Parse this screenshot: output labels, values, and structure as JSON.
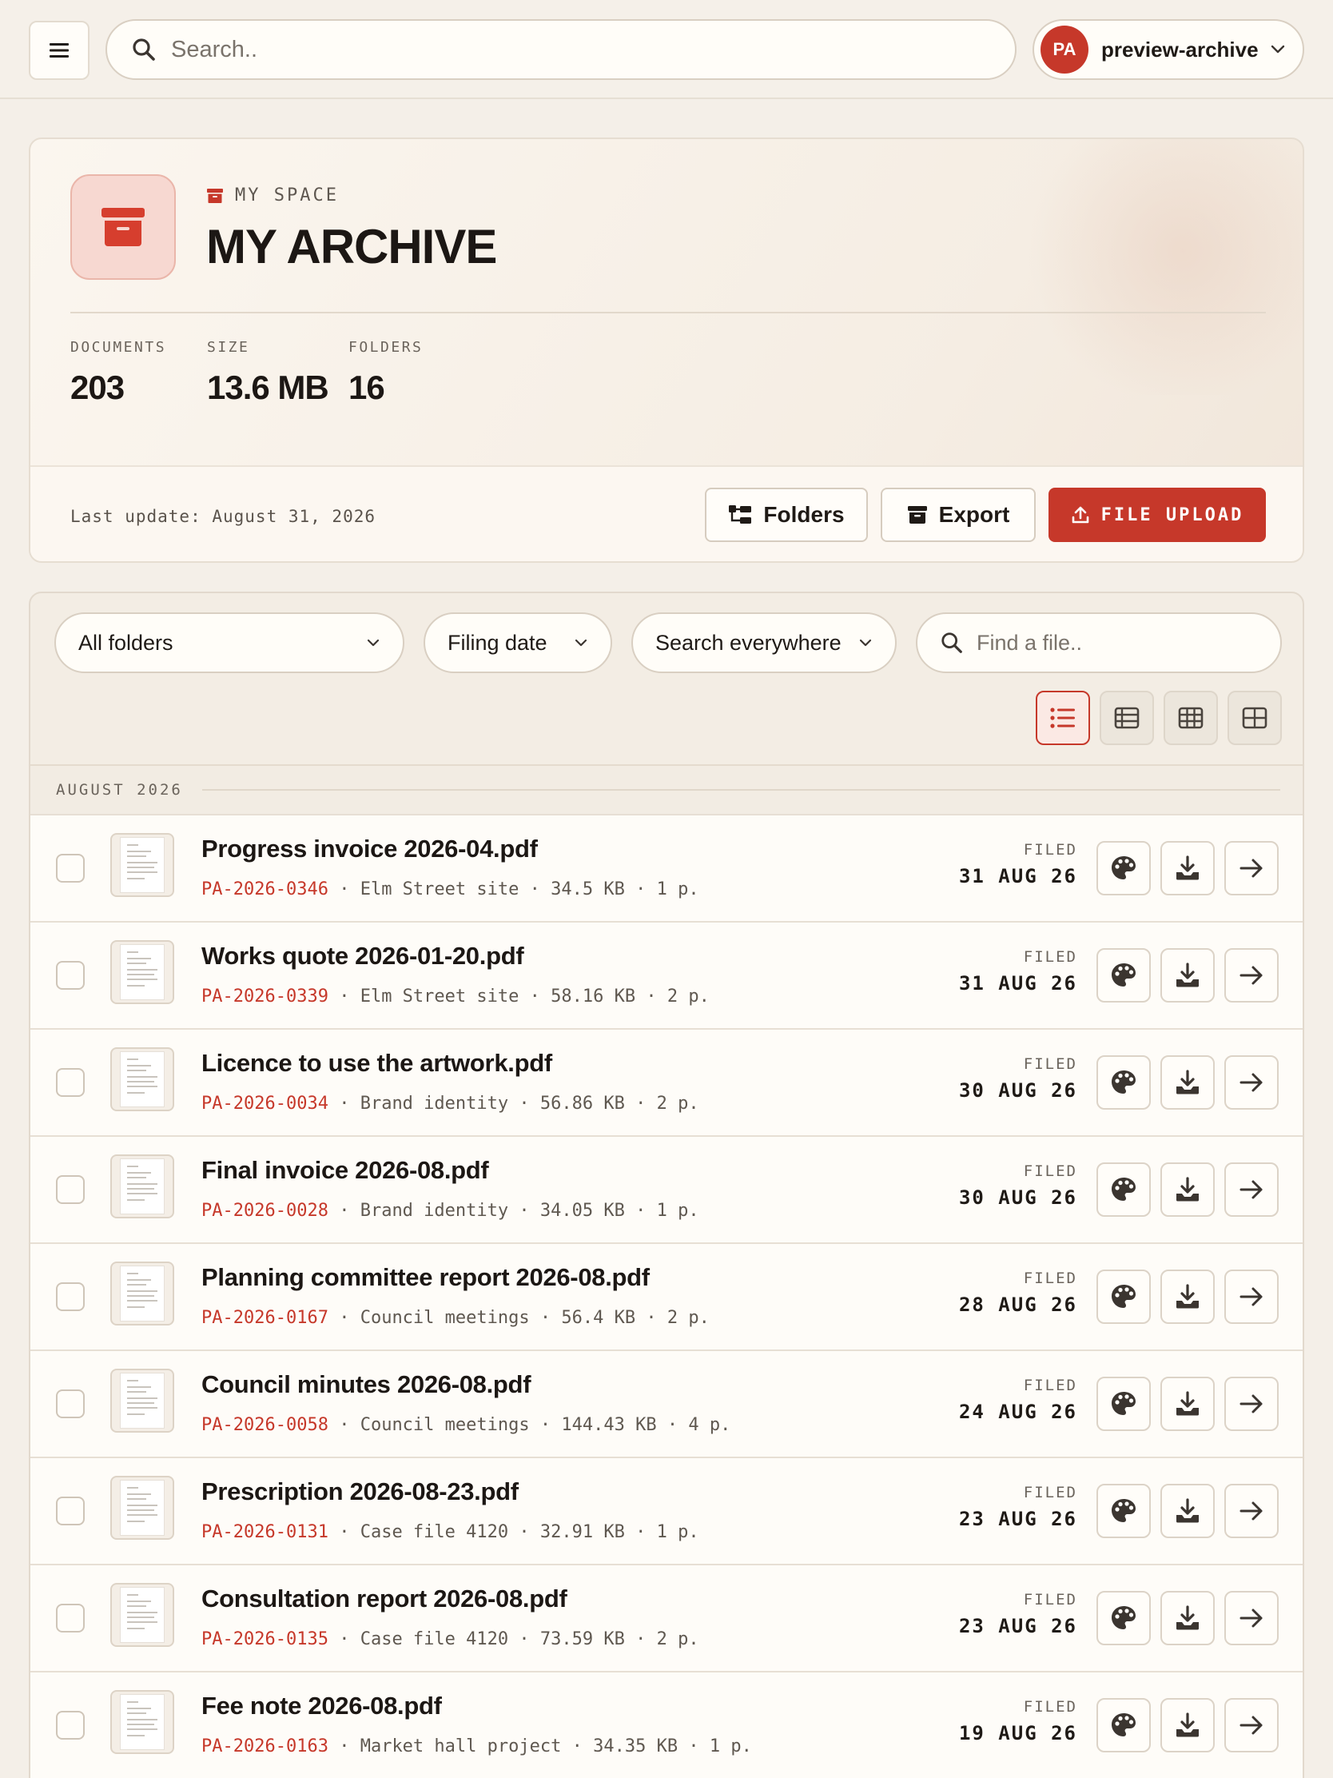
{
  "topbar": {
    "search_placeholder": "Search..",
    "user": {
      "initials": "PA",
      "name": "preview-archive"
    }
  },
  "hero": {
    "eyebrow": "MY SPACE",
    "title": "MY ARCHIVE",
    "stats": [
      {
        "label": "DOCUMENTS",
        "value": "203"
      },
      {
        "label": "SIZE",
        "value": "13.6 MB"
      },
      {
        "label": "FOLDERS",
        "value": "16"
      }
    ],
    "last_update": "Last update: August 31, 2026",
    "buttons": {
      "folders": "Folders",
      "export": "Export",
      "upload": "FILE UPLOAD"
    }
  },
  "filters": {
    "folder": "All folders",
    "date": "Filing date",
    "scope": "Search everywhere",
    "find_placeholder": "Find a file.."
  },
  "group": {
    "label": "AUGUST 2026"
  },
  "filed_label": "FILED",
  "documents": [
    {
      "title": "Progress invoice 2026-04.pdf",
      "ref": "PA-2026-0346",
      "folder": "Elm Street site",
      "size": "34.5 KB",
      "pages": "1 p.",
      "filed": "31 AUG 26"
    },
    {
      "title": "Works quote 2026-01-20.pdf",
      "ref": "PA-2026-0339",
      "folder": "Elm Street site",
      "size": "58.16 KB",
      "pages": "2 p.",
      "filed": "31 AUG 26"
    },
    {
      "title": "Licence to use the artwork.pdf",
      "ref": "PA-2026-0034",
      "folder": "Brand identity",
      "size": "56.86 KB",
      "pages": "2 p.",
      "filed": "30 AUG 26"
    },
    {
      "title": "Final invoice 2026-08.pdf",
      "ref": "PA-2026-0028",
      "folder": "Brand identity",
      "size": "34.05 KB",
      "pages": "1 p.",
      "filed": "30 AUG 26"
    },
    {
      "title": "Planning committee report 2026-08.pdf",
      "ref": "PA-2026-0167",
      "folder": "Council meetings",
      "size": "56.4 KB",
      "pages": "2 p.",
      "filed": "28 AUG 26"
    },
    {
      "title": "Council minutes 2026-08.pdf",
      "ref": "PA-2026-0058",
      "folder": "Council meetings",
      "size": "144.43 KB",
      "pages": "4 p.",
      "filed": "24 AUG 26"
    },
    {
      "title": "Prescription 2026-08-23.pdf",
      "ref": "PA-2026-0131",
      "folder": "Case file 4120",
      "size": "32.91 KB",
      "pages": "1 p.",
      "filed": "23 AUG 26"
    },
    {
      "title": "Consultation report 2026-08.pdf",
      "ref": "PA-2026-0135",
      "folder": "Case file 4120",
      "size": "73.59 KB",
      "pages": "2 p.",
      "filed": "23 AUG 26"
    },
    {
      "title": "Fee note 2026-08.pdf",
      "ref": "PA-2026-0163",
      "folder": "Market hall project",
      "size": "34.35 KB",
      "pages": "1 p.",
      "filed": "19 AUG 26"
    }
  ],
  "colors": {
    "accent": "#c6382a",
    "background": "#f4efe8"
  }
}
